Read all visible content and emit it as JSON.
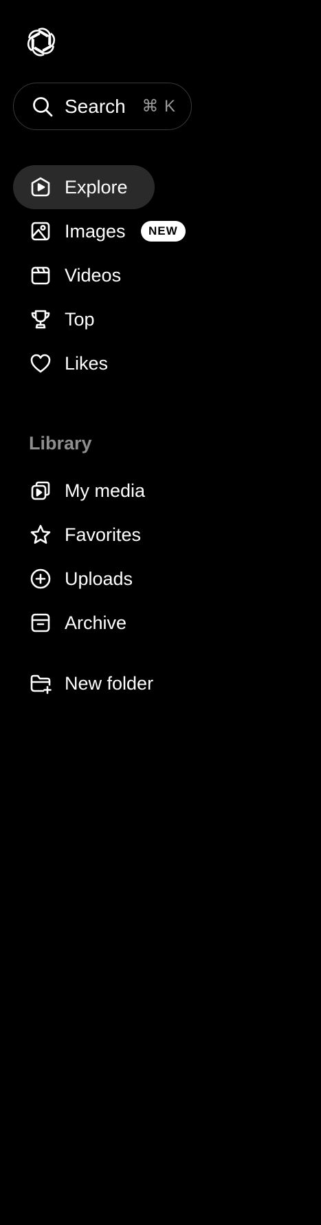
{
  "logo": {
    "icon": "openai-logo-icon"
  },
  "search": {
    "label": "Search",
    "shortcut": "⌘ K",
    "icon": "search-icon"
  },
  "nav": {
    "explore": {
      "label": "Explore",
      "icon": "explore-icon",
      "active": true
    },
    "images": {
      "label": "Images",
      "icon": "image-icon",
      "badge": "NEW"
    },
    "videos": {
      "label": "Videos",
      "icon": "video-icon"
    },
    "top": {
      "label": "Top",
      "icon": "trophy-icon"
    },
    "likes": {
      "label": "Likes",
      "icon": "heart-icon"
    }
  },
  "library": {
    "title": "Library",
    "items": {
      "my_media": {
        "label": "My media",
        "icon": "media-icon"
      },
      "favorites": {
        "label": "Favorites",
        "icon": "star-icon"
      },
      "uploads": {
        "label": "Uploads",
        "icon": "plus-circle-icon"
      },
      "archive": {
        "label": "Archive",
        "icon": "archive-icon"
      }
    },
    "new_folder": {
      "label": "New folder",
      "icon": "folder-plus-icon"
    }
  },
  "colors": {
    "background": "#000000",
    "active_item": "#2a2a2a",
    "muted_text": "#8e8e8e",
    "border": "#3a3a3a"
  }
}
